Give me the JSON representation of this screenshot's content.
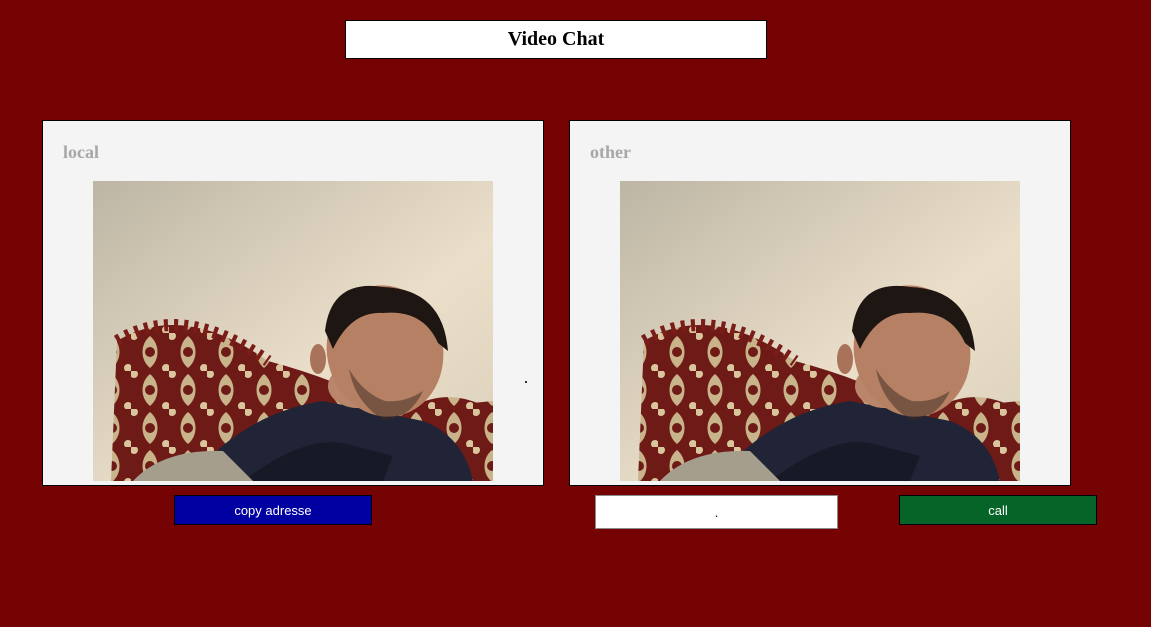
{
  "header": {
    "title": "Video Chat"
  },
  "local_panel": {
    "label": "local",
    "video_icon": "webcam-feed"
  },
  "other_panel": {
    "label": "other",
    "video_icon": "webcam-feed"
  },
  "controls": {
    "copy_label": "copy adresse",
    "address_value": ".",
    "address_placeholder": "",
    "call_label": "call"
  },
  "colors": {
    "background": "#760303",
    "panel": "#f4f4f4",
    "copy_button": "#0000a2",
    "call_button": "#056529",
    "panel_label": "#a7a7a7"
  }
}
